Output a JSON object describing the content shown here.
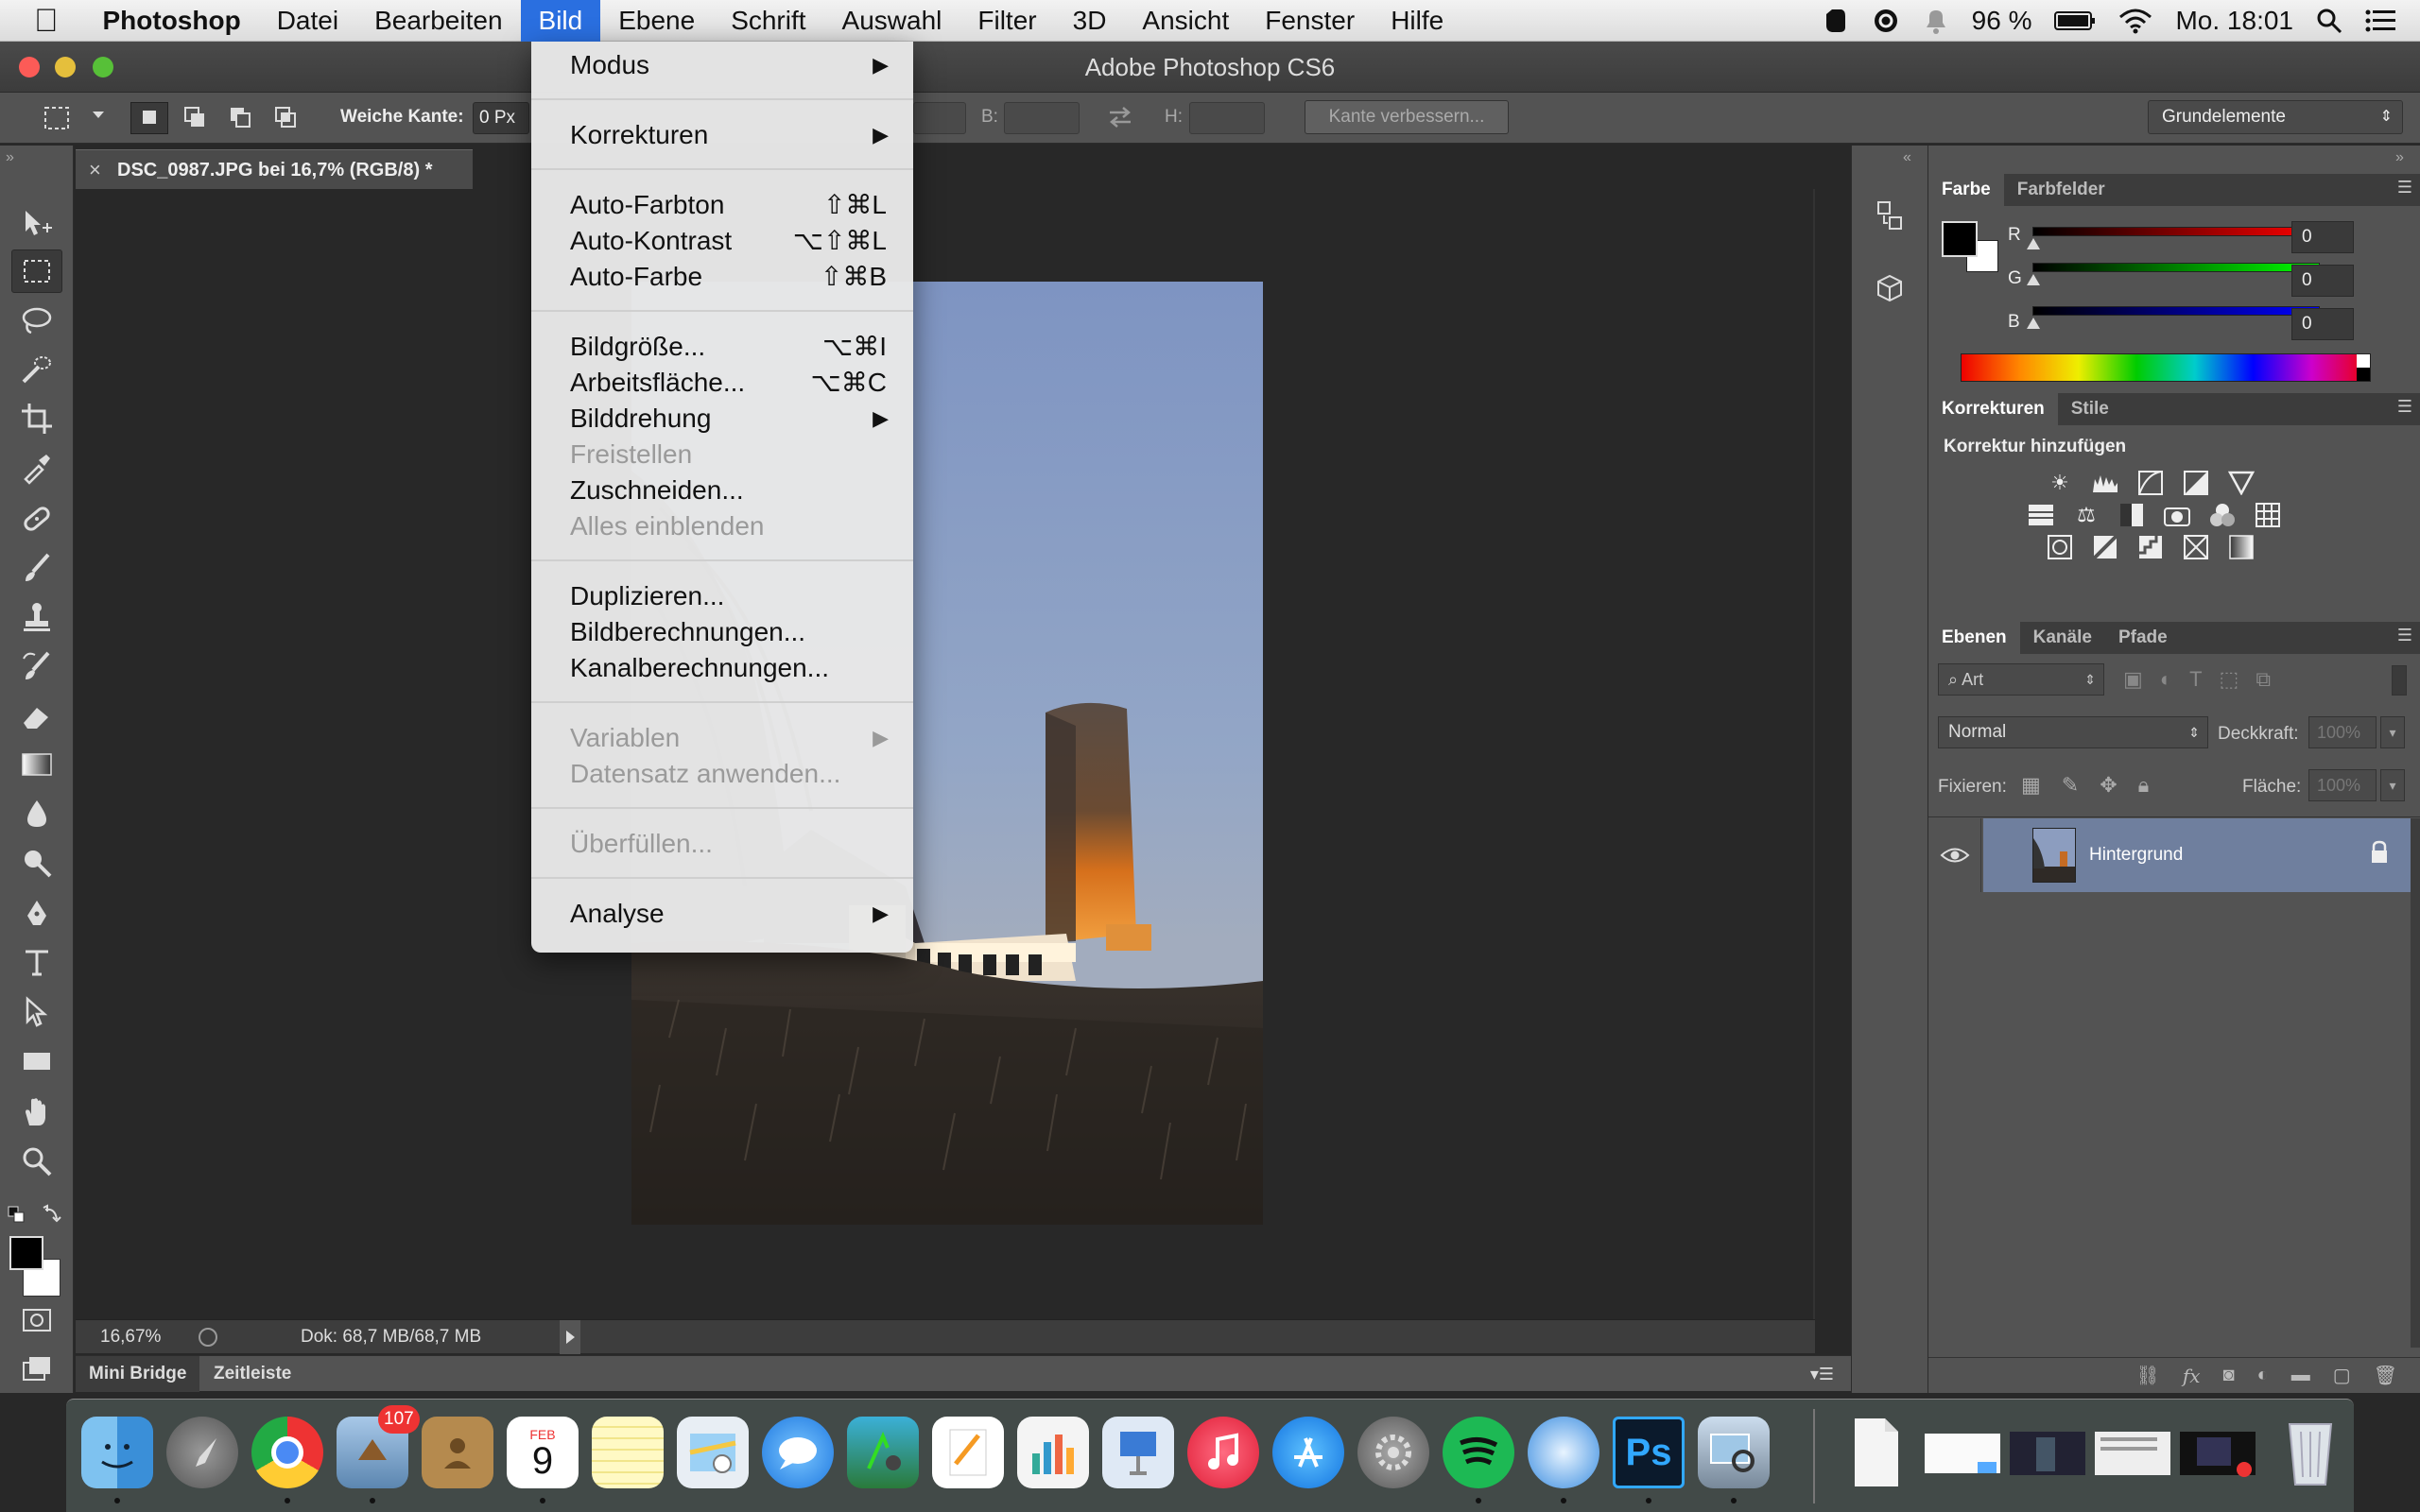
{
  "menubar": {
    "apple": "",
    "app": "Photoshop",
    "items": [
      "Datei",
      "Bearbeiten",
      "Bild",
      "Ebene",
      "Schrift",
      "Auswahl",
      "Filter",
      "3D",
      "Ansicht",
      "Fenster",
      "Hilfe"
    ],
    "active": "Bild",
    "battery": "96 %",
    "clock": "Mo. 18:01"
  },
  "window": {
    "title": "Adobe Photoshop CS6"
  },
  "options": {
    "feather_label": "Weiche Kante:",
    "feather_value": "0 Px",
    "width_label": "B:",
    "height_label": "H:",
    "refine_button": "Kante verbessern...",
    "workspace": "Grundelemente"
  },
  "document": {
    "tab": "DSC_0987.JPG bei 16,7% (RGB/8) *",
    "zoom": "16,67%",
    "doc_size": "Dok: 68,7 MB/68,7 MB"
  },
  "bottom_tabs": [
    "Mini Bridge",
    "Zeitleiste"
  ],
  "menu": {
    "groups": [
      [
        {
          "label": "Modus",
          "submenu": true
        }
      ],
      [
        {
          "label": "Korrekturen",
          "submenu": true
        }
      ],
      [
        {
          "label": "Auto-Farbton",
          "shortcut": "⇧⌘L"
        },
        {
          "label": "Auto-Kontrast",
          "shortcut": "⌥⇧⌘L"
        },
        {
          "label": "Auto-Farbe",
          "shortcut": "⇧⌘B"
        }
      ],
      [
        {
          "label": "Bildgröße...",
          "shortcut": "⌥⌘I"
        },
        {
          "label": "Arbeitsfläche...",
          "shortcut": "⌥⌘C"
        },
        {
          "label": "Bilddrehung",
          "submenu": true
        },
        {
          "label": "Freistellen",
          "disabled": true
        },
        {
          "label": "Zuschneiden..."
        },
        {
          "label": "Alles einblenden",
          "disabled": true
        }
      ],
      [
        {
          "label": "Duplizieren..."
        },
        {
          "label": "Bildberechnungen..."
        },
        {
          "label": "Kanalberechnungen..."
        }
      ],
      [
        {
          "label": "Variablen",
          "submenu": true,
          "disabled": true
        },
        {
          "label": "Datensatz anwenden...",
          "disabled": true
        }
      ],
      [
        {
          "label": "Überfüllen...",
          "disabled": true
        }
      ],
      [
        {
          "label": "Analyse",
          "submenu": true
        }
      ]
    ]
  },
  "color_panel": {
    "tabs": [
      "Farbe",
      "Farbfelder"
    ],
    "channels": [
      {
        "name": "R",
        "value": "0"
      },
      {
        "name": "G",
        "value": "0"
      },
      {
        "name": "B",
        "value": "0"
      }
    ]
  },
  "adjust_panel": {
    "tabs": [
      "Korrekturen",
      "Stile"
    ],
    "heading": "Korrektur hinzufügen"
  },
  "layers_panel": {
    "tabs": [
      "Ebenen",
      "Kanäle",
      "Pfade"
    ],
    "filter": "Art",
    "blend_mode": "Normal",
    "opacity_label": "Deckkraft:",
    "opacity": "100%",
    "lock_label": "Fixieren:",
    "fill_label": "Fläche:",
    "fill": "100%",
    "layers": [
      {
        "name": "Hintergrund",
        "locked": true,
        "visible": true
      }
    ]
  },
  "dock": {
    "mail_badge": "107",
    "calendar_month": "FEB",
    "calendar_day": "9"
  },
  "colors": {
    "accent": "#2a6fe0",
    "panel": "#535353",
    "canvas": "#282828",
    "layer_selected": "#6f7f9e"
  }
}
